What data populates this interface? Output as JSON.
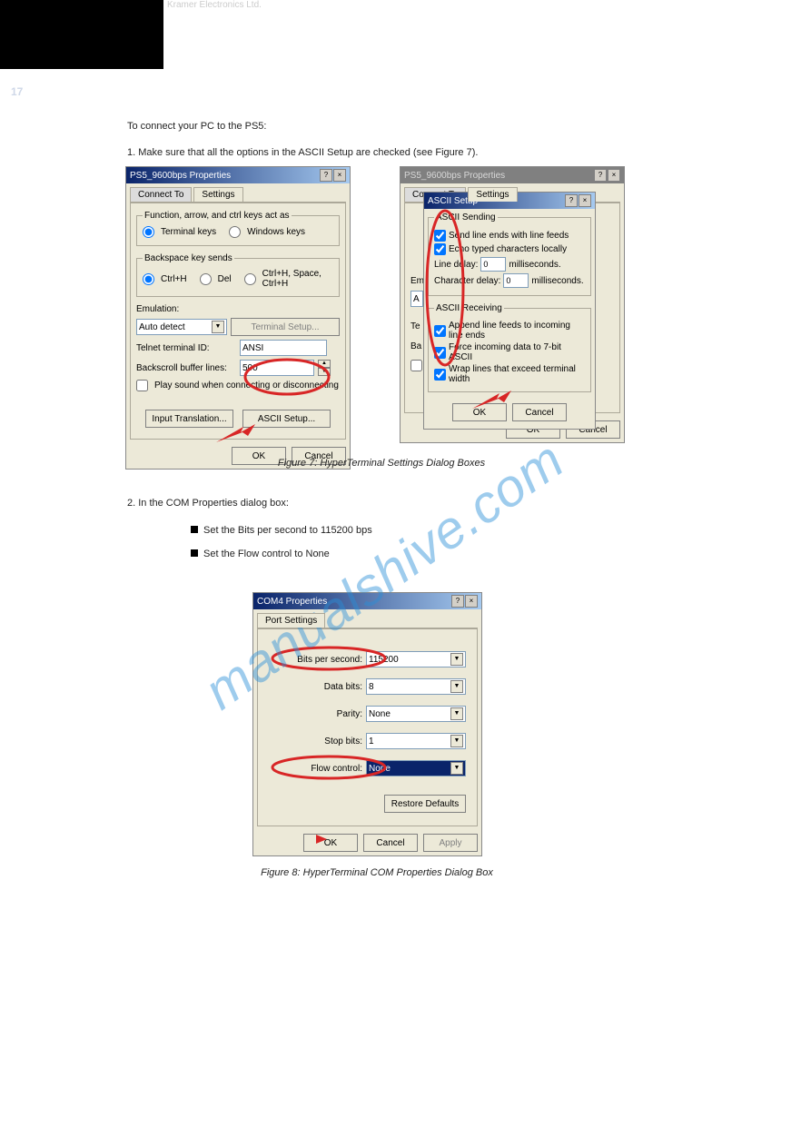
{
  "header": "Kramer Electronics Ltd.",
  "pageNumber": "17",
  "intro": "To connect your PC to the PS5:",
  "step1": "1.  Make sure that all the options in the ASCII Setup are checked (see Figure 7).",
  "fig7": "Figure 7: HyperTerminal Settings Dialog Boxes",
  "note_a": "2.  In the COM Properties dialog box:",
  "note_b": "Set the Bits per second to 115200 bps",
  "note_c": "Set the Flow control to None",
  "fig8": "Figure 8: HyperTerminal COM Properties Dialog Box",
  "dlg1": {
    "title": "PS5_9600bps Properties",
    "tabConnect": "Connect To",
    "tabSettings": "Settings",
    "fs1": "Function, arrow, and ctrl keys act as",
    "r_term": "Terminal keys",
    "r_win": "Windows keys",
    "fs2": "Backspace key sends",
    "r_ctrlh": "Ctrl+H",
    "r_del": "Del",
    "r_ctrlh2": "Ctrl+H, Space, Ctrl+H",
    "emulation_lbl": "Emulation:",
    "emulation": "Auto detect",
    "termsetup": "Terminal Setup...",
    "telnet_lbl": "Telnet terminal ID:",
    "telnet": "ANSI",
    "buffer_lbl": "Backscroll buffer lines:",
    "buffer": "500",
    "chk_sound": "Play sound when connecting or disconnecting",
    "btn_input": "Input Translation...",
    "btn_ascii": "ASCII Setup...",
    "ok": "OK",
    "cancel": "Cancel"
  },
  "dlg2": {
    "title": "PS5_9600bps Properties",
    "tabConnect": "Connect To",
    "tabSettings": "Settings",
    "emulation_lbl": "Em",
    "emulation": "A",
    "telnet_lbl": "Te",
    "buffer_lbl": "Ba",
    "ok": "OK",
    "cancel": "Cancel"
  },
  "ascii": {
    "title": "ASCII Setup",
    "fs_send": "ASCII Sending",
    "c1": "Send line ends with line feeds",
    "c2": "Echo typed characters locally",
    "line_delay_lbl": "Line delay:",
    "line_delay": "0",
    "line_delay_unit": "milliseconds.",
    "char_delay_lbl": "Character delay:",
    "char_delay": "0",
    "char_delay_unit": "milliseconds.",
    "fs_recv": "ASCII Receiving",
    "c3": "Append line feeds to incoming line ends",
    "c4": "Force incoming data to 7-bit ASCII",
    "c5": "Wrap lines that exceed terminal width",
    "ok": "OK",
    "cancel": "Cancel"
  },
  "com": {
    "title": "COM4 Properties",
    "tab": "Port Settings",
    "bits_lbl": "Bits per second:",
    "bits": "115200",
    "data_lbl": "Data bits:",
    "data": "8",
    "parity_lbl": "Parity:",
    "parity": "None",
    "stop_lbl": "Stop bits:",
    "stop": "1",
    "flow_lbl": "Flow control:",
    "flow": "None",
    "restore": "Restore Defaults",
    "ok": "OK",
    "cancel": "Cancel",
    "apply": "Apply"
  },
  "watermark": "manualshive.com"
}
